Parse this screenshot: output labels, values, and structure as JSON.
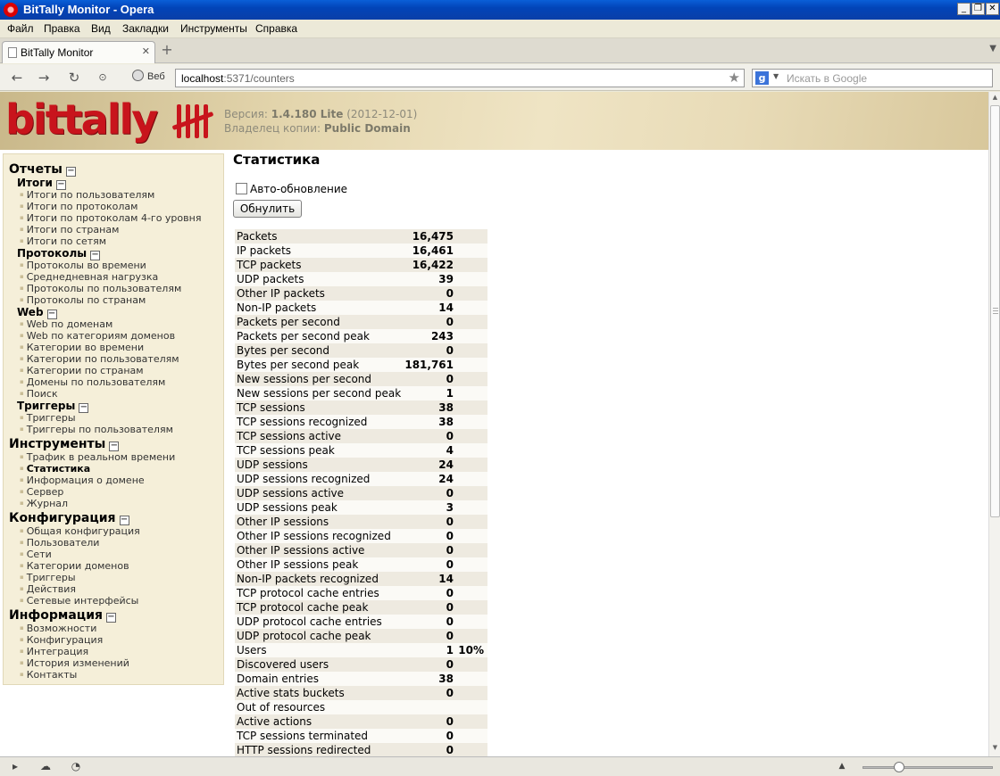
{
  "window": {
    "title": "BitTally Monitor - Opera",
    "controls": [
      "_",
      "❐",
      "✕"
    ]
  },
  "menu": [
    "Файл",
    "Правка",
    "Вид",
    "Закладки",
    "Инструменты",
    "Справка"
  ],
  "tab": {
    "label": "BitTally Monitor",
    "close": "✕",
    "new": "+"
  },
  "toolbar": {
    "web_label": "Веб",
    "url_host": "localhost",
    "url_path": ":5371/counters",
    "search_engine": "g",
    "search_placeholder": "Искать в Google"
  },
  "banner": {
    "logo": "bittally",
    "version_label": "Версия:",
    "version_value": "1.4.180 Lite",
    "version_date": "(2012-12-01)",
    "owner_label": "Владелец копии:",
    "owner_value": "Public Domain"
  },
  "sidebar": {
    "reports": "Отчеты",
    "totals": "Итоги",
    "totals_items": [
      "Итоги по пользователям",
      "Итоги по протоколам",
      "Итоги по протоколам 4-го уровня",
      "Итоги по странам",
      "Итоги по сетям"
    ],
    "protocols": "Протоколы",
    "protocols_items": [
      "Протоколы во времени",
      "Среднедневная нагрузка",
      "Протоколы по пользователям",
      "Протоколы по странам"
    ],
    "web": "Web",
    "web_items": [
      "Web по доменам",
      "Web по категориям доменов",
      "Категории во времени",
      "Категории по пользователям",
      "Категории по странам",
      "Домены по пользователям",
      "Поиск"
    ],
    "triggers": "Триггеры",
    "triggers_items": [
      "Триггеры",
      "Триггеры по пользователям"
    ],
    "tools": "Инструменты",
    "tools_items": [
      "Трафик в реальном времени",
      "Статистика",
      "Информация о домене",
      "Сервер",
      "Журнал"
    ],
    "config": "Конфигурация",
    "config_items": [
      "Общая конфигурация",
      "Пользователи",
      "Сети",
      "Категории доменов",
      "Триггеры",
      "Действия",
      "Сетевые интерфейсы"
    ],
    "info": "Информация",
    "info_items": [
      "Возможности",
      "Конфигурация",
      "Интеграция",
      "История изменений",
      "Контакты"
    ],
    "toggle": "−"
  },
  "main": {
    "title": "Статистика",
    "auto_refresh": "Авто-обновление",
    "reset": "Обнулить",
    "stats": [
      {
        "label": "Packets",
        "value": "16,475",
        "pct": ""
      },
      {
        "label": "IP packets",
        "value": "16,461",
        "pct": ""
      },
      {
        "label": "TCP packets",
        "value": "16,422",
        "pct": ""
      },
      {
        "label": "UDP packets",
        "value": "39",
        "pct": ""
      },
      {
        "label": "Other IP packets",
        "value": "0",
        "pct": ""
      },
      {
        "label": "Non-IP packets",
        "value": "14",
        "pct": ""
      },
      {
        "label": "Packets per second",
        "value": "0",
        "pct": ""
      },
      {
        "label": "Packets per second peak",
        "value": "243",
        "pct": ""
      },
      {
        "label": "Bytes per second",
        "value": "0",
        "pct": ""
      },
      {
        "label": "Bytes per second peak",
        "value": "181,761",
        "pct": ""
      },
      {
        "label": "New sessions per second",
        "value": "0",
        "pct": ""
      },
      {
        "label": "New sessions per second peak",
        "value": "1",
        "pct": ""
      },
      {
        "label": "TCP sessions",
        "value": "38",
        "pct": ""
      },
      {
        "label": "TCP sessions recognized",
        "value": "38",
        "pct": ""
      },
      {
        "label": "TCP sessions active",
        "value": "0",
        "pct": ""
      },
      {
        "label": "TCP sessions peak",
        "value": "4",
        "pct": ""
      },
      {
        "label": "UDP sessions",
        "value": "24",
        "pct": ""
      },
      {
        "label": "UDP sessions recognized",
        "value": "24",
        "pct": ""
      },
      {
        "label": "UDP sessions active",
        "value": "0",
        "pct": ""
      },
      {
        "label": "UDP sessions peak",
        "value": "3",
        "pct": ""
      },
      {
        "label": "Other IP sessions",
        "value": "0",
        "pct": ""
      },
      {
        "label": "Other IP sessions recognized",
        "value": "0",
        "pct": ""
      },
      {
        "label": "Other IP sessions active",
        "value": "0",
        "pct": ""
      },
      {
        "label": "Other IP sessions peak",
        "value": "0",
        "pct": ""
      },
      {
        "label": "Non-IP packets recognized",
        "value": "14",
        "pct": ""
      },
      {
        "label": "TCP protocol cache entries",
        "value": "0",
        "pct": ""
      },
      {
        "label": "TCP protocol cache peak",
        "value": "0",
        "pct": ""
      },
      {
        "label": "UDP protocol cache entries",
        "value": "0",
        "pct": ""
      },
      {
        "label": "UDP protocol cache peak",
        "value": "0",
        "pct": ""
      },
      {
        "label": "Users",
        "value": "1",
        "pct": "10%"
      },
      {
        "label": "Discovered users",
        "value": "0",
        "pct": ""
      },
      {
        "label": "Domain entries",
        "value": "38",
        "pct": ""
      },
      {
        "label": "Active stats buckets",
        "value": "0",
        "pct": ""
      },
      {
        "label": "Out of resources",
        "value": "",
        "pct": ""
      },
      {
        "label": "Active actions",
        "value": "0",
        "pct": ""
      },
      {
        "label": "TCP sessions terminated",
        "value": "0",
        "pct": ""
      },
      {
        "label": "HTTP sessions redirected",
        "value": "0",
        "pct": ""
      }
    ]
  }
}
